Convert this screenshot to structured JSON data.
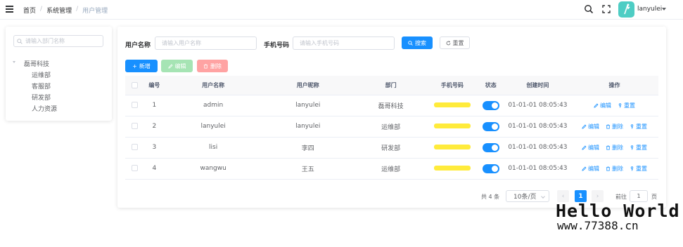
{
  "header": {
    "breadcrumbs": [
      "首页",
      "系统管理",
      "用户管理"
    ],
    "username": "lanyulei"
  },
  "tree": {
    "search_placeholder": "请输入部门名称",
    "root": "磊哥科技",
    "children": [
      "运维部",
      "客服部",
      "研发部",
      "人力资源"
    ]
  },
  "form": {
    "username_label": "用户名称",
    "username_placeholder": "请输入用户名称",
    "phone_label": "手机号码",
    "phone_placeholder": "请输入手机号码",
    "search_btn": "搜索",
    "reset_btn": "重置"
  },
  "toolbar": {
    "add": "新增",
    "edit": "编辑",
    "delete": "删除"
  },
  "table": {
    "columns": [
      "编号",
      "用户名称",
      "用户昵称",
      "部门",
      "手机号码",
      "状态",
      "创建时间",
      "操作"
    ],
    "rows": [
      {
        "id": "1",
        "username": "admin",
        "nickname": "lanyulei",
        "dept": "磊哥科技",
        "created": "01-01-01 08:05:43"
      },
      {
        "id": "2",
        "username": "lanyulei",
        "nickname": "lanyulei",
        "dept": "运维部",
        "created": "01-01-01 08:05:43"
      },
      {
        "id": "3",
        "username": "lisi",
        "nickname": "李四",
        "dept": "研发部",
        "created": "01-01-01 08:05:43"
      },
      {
        "id": "4",
        "username": "wangwu",
        "nickname": "王五",
        "dept": "运维部",
        "created": "01-01-01 08:05:43"
      }
    ],
    "op_edit": "编辑",
    "op_delete": "删除",
    "op_reset": "重置"
  },
  "pagination": {
    "total": "共 4 条",
    "page_size": "10条/页",
    "current_page": "1",
    "goto_label": "前往",
    "goto_value": "1",
    "page_unit": "页"
  },
  "watermark": {
    "line1": "Hello World",
    "line2": "www.77388.cn"
  },
  "colors": {
    "primary": "#1890ff",
    "success_light": "#a6e4b4",
    "danger_light": "#ffa3a3",
    "avatar": "#4ecdc4"
  }
}
